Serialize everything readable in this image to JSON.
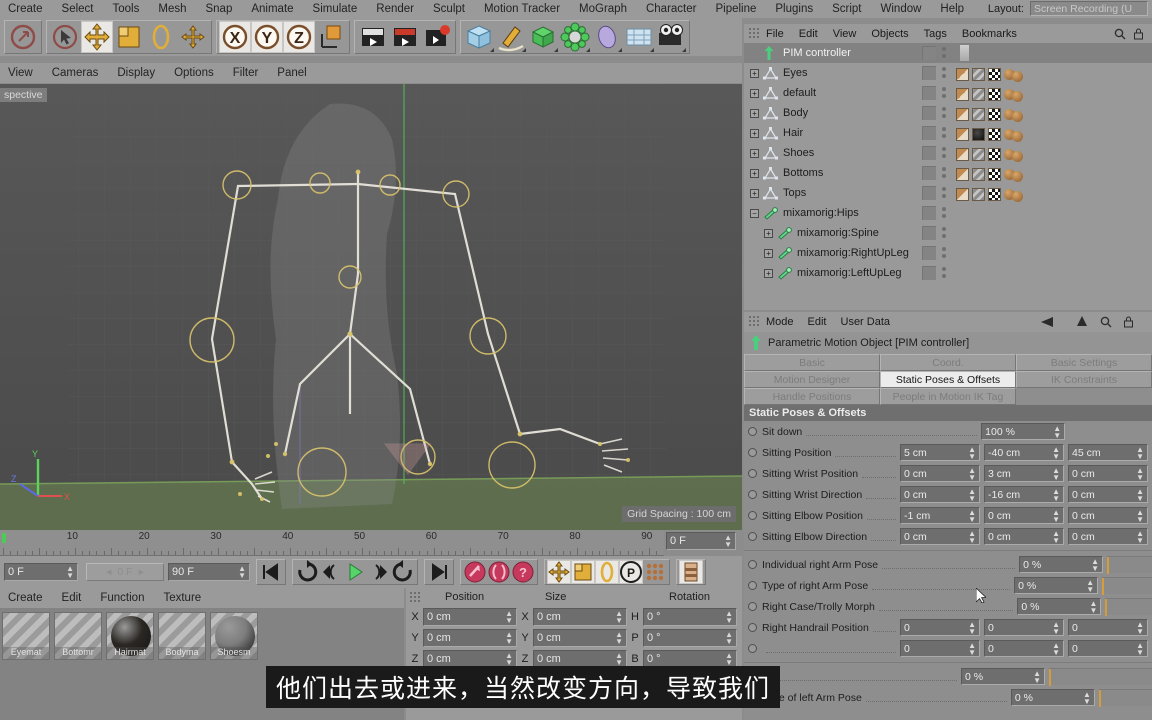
{
  "top_menu": {
    "items": [
      "Create",
      "Select",
      "Tools",
      "Mesh",
      "Snap",
      "Animate",
      "Simulate",
      "Render",
      "Sculpt",
      "Motion Tracker",
      "MoGraph",
      "Character",
      "Pipeline",
      "Plugins",
      "Script",
      "Window",
      "Help"
    ],
    "layout_label": "Layout:",
    "layout_value": "Screen Recording (U"
  },
  "toolbar": {
    "icons": [
      {
        "name": "undo-icon",
        "glyph": "↶"
      },
      {
        "name": "select-tool-icon",
        "glyph": "↖"
      },
      {
        "name": "move-tool-icon",
        "glyph": "✛"
      },
      {
        "name": "scale-tool-icon",
        "glyph": "◰"
      },
      {
        "name": "rotate-tool-icon",
        "glyph": "◯"
      },
      {
        "name": "world-axis-icon",
        "glyph": "✣"
      },
      {
        "name": "lock-x-axis-icon",
        "glyph": "X"
      },
      {
        "name": "lock-y-axis-icon",
        "glyph": "Y"
      },
      {
        "name": "lock-z-axis-icon",
        "glyph": "Z"
      },
      {
        "name": "object-world-coord-icon",
        "glyph": "◱"
      },
      {
        "name": "render-view-icon",
        "glyph": "▶"
      },
      {
        "name": "render-picture-viewer-icon",
        "glyph": "▶"
      },
      {
        "name": "render-settings-icon",
        "glyph": "▶"
      },
      {
        "name": "cube-primitive-icon",
        "glyph": "⬛"
      },
      {
        "name": "spline-pen-icon",
        "glyph": "✒"
      },
      {
        "name": "generator-icon",
        "glyph": "⬛"
      },
      {
        "name": "deformer-icon",
        "glyph": "✿"
      },
      {
        "name": "environment-icon",
        "glyph": "●"
      },
      {
        "name": "floor-scene-icon",
        "glyph": "▤"
      },
      {
        "name": "camera-icon",
        "glyph": "◎"
      }
    ]
  },
  "viewport": {
    "menu": [
      "View",
      "Cameras",
      "Display",
      "Options",
      "Filter",
      "Panel"
    ],
    "perspective_label": "spective",
    "grid_spacing": "Grid Spacing : 100 cm",
    "axis_labels": {
      "y": "Y",
      "x": "X",
      "z": "Z"
    },
    "corner_icons": [
      "move-view-icon",
      "pan-view-icon",
      "rotate-view-icon",
      "maximize-view-icon"
    ]
  },
  "timeline": {
    "ticks": [
      "10",
      "20",
      "30",
      "40",
      "50",
      "60",
      "70",
      "80",
      "90"
    ],
    "current_frame": "0 F",
    "start_field": "0 F",
    "preview_field": "0 F",
    "end_field": "90 F",
    "buttons": [
      {
        "name": "go-to-start-button",
        "glyph": "⏮"
      },
      {
        "name": "loop-preview-button",
        "glyph": "↻"
      },
      {
        "name": "step-back-button",
        "glyph": "◁"
      },
      {
        "name": "play-button",
        "glyph": "▶"
      },
      {
        "name": "step-forward-button",
        "glyph": "▷"
      },
      {
        "name": "loop-button",
        "glyph": "↺"
      },
      {
        "name": "go-to-end-button",
        "glyph": "⏭"
      },
      {
        "name": "record-keyframe-button",
        "glyph": "✦"
      },
      {
        "name": "autokey-button",
        "glyph": "●"
      },
      {
        "name": "keyframe-selection-button",
        "glyph": "?"
      },
      {
        "name": "key-position-button",
        "glyph": "✛"
      },
      {
        "name": "key-scale-button",
        "glyph": "◰"
      },
      {
        "name": "key-rotation-button",
        "glyph": "◯"
      },
      {
        "name": "key-pla-button",
        "glyph": "P"
      },
      {
        "name": "key-parameter-button",
        "glyph": "∷"
      },
      {
        "name": "timeline-layout-button",
        "glyph": "☰"
      }
    ]
  },
  "material_manager": {
    "menu": [
      "Create",
      "Edit",
      "Function",
      "Texture"
    ],
    "materials": [
      {
        "name": "Eyemat",
        "color": "#8a8a8a",
        "shine": false
      },
      {
        "name": "Bottomr",
        "color": "#8a8a8a",
        "shine": false
      },
      {
        "name": "Hairmat",
        "color": "#2b2723",
        "shine": true
      },
      {
        "name": "Bodyma",
        "color": "#8a8a8a",
        "shine": false
      },
      {
        "name": "Shoesm",
        "color": "#7d7d7d",
        "shine": true
      }
    ]
  },
  "coordinates": {
    "headers": [
      "Position",
      "Size",
      "Rotation"
    ],
    "rows": [
      {
        "axis1": "X",
        "pos": "0 cm",
        "axis2": "X",
        "size": "0 cm",
        "axis3": "H",
        "rot": "0 °"
      },
      {
        "axis1": "Y",
        "pos": "0 cm",
        "axis2": "Y",
        "size": "0 cm",
        "axis3": "P",
        "rot": "0 °"
      },
      {
        "axis1": "Z",
        "pos": "0 cm",
        "axis2": "Z",
        "size": "0 cm",
        "axis3": "B",
        "rot": "0 °"
      }
    ]
  },
  "object_manager": {
    "menu": [
      "File",
      "Edit",
      "View",
      "Objects",
      "Tags",
      "Bookmarks"
    ],
    "header_icons": [
      "search-icon",
      "lock-icon"
    ],
    "items": [
      {
        "label": "PIM controller",
        "icon": "pim-controller-icon",
        "indent": 0,
        "expander": "",
        "selected": true,
        "tags": []
      },
      {
        "label": "Eyes",
        "icon": "polygon-object-icon",
        "indent": 0,
        "expander": "+",
        "selected": false,
        "tags": [
          "texture-tag",
          "hair-tag",
          "checker-tag",
          "selection-tag"
        ]
      },
      {
        "label": "default",
        "icon": "polygon-object-icon",
        "indent": 0,
        "expander": "+",
        "selected": false,
        "tags": [
          "texture-tag",
          "hair-tag",
          "checker-tag",
          "selection-tag"
        ]
      },
      {
        "label": "Body",
        "icon": "polygon-object-icon",
        "indent": 0,
        "expander": "+",
        "selected": false,
        "tags": [
          "texture-tag",
          "hair-tag",
          "checker-tag",
          "selection-tag"
        ]
      },
      {
        "label": "Hair",
        "icon": "polygon-object-icon",
        "indent": 0,
        "expander": "+",
        "selected": false,
        "tags": [
          "texture-tag",
          "hair-dark-tag",
          "checker-tag",
          "selection-tag"
        ]
      },
      {
        "label": "Shoes",
        "icon": "polygon-object-icon",
        "indent": 0,
        "expander": "+",
        "selected": false,
        "tags": [
          "texture-tag",
          "hair-tag",
          "checker-tag",
          "selection-tag"
        ]
      },
      {
        "label": "Bottoms",
        "icon": "polygon-object-icon",
        "indent": 0,
        "expander": "+",
        "selected": false,
        "tags": [
          "texture-tag",
          "hair-tag",
          "checker-tag",
          "selection-tag"
        ]
      },
      {
        "label": "Tops",
        "icon": "polygon-object-icon",
        "indent": 0,
        "expander": "+",
        "selected": false,
        "tags": [
          "texture-tag",
          "hair-tag",
          "checker-tag",
          "selection-tag"
        ]
      },
      {
        "label": "mixamorig:Hips",
        "icon": "joint-icon",
        "indent": 0,
        "expander": "−",
        "selected": false,
        "tags": []
      },
      {
        "label": "mixamorig:Spine",
        "icon": "joint-icon",
        "indent": 1,
        "expander": "+",
        "selected": false,
        "tags": []
      },
      {
        "label": "mixamorig:RightUpLeg",
        "icon": "joint-icon",
        "indent": 1,
        "expander": "+",
        "selected": false,
        "tags": []
      },
      {
        "label": "mixamorig:LeftUpLeg",
        "icon": "joint-icon",
        "indent": 1,
        "expander": "+",
        "selected": false,
        "tags": []
      }
    ]
  },
  "attribute_manager": {
    "menu": [
      "Mode",
      "Edit",
      "User Data"
    ],
    "nav_icons": [
      "back-arrow-icon",
      "up-arrow-icon",
      "search-icon",
      "lock-icon"
    ],
    "object_title": "Parametric Motion Object [PIM controller]",
    "object_icon": "pim-controller-icon",
    "tabs": [
      [
        "Basic",
        "Coord.",
        "Basic Settings"
      ],
      [
        "Motion Designer",
        "Static Poses & Offsets",
        "IK Constraints"
      ],
      [
        "Handle Positions",
        "People in Motion IK Tag",
        ""
      ]
    ],
    "active_tab": "Static Poses & Offsets",
    "section_header": "Static Poses & Offsets",
    "params": [
      {
        "label": "Sit down",
        "values": [
          "100 %"
        ],
        "slider": false
      },
      {
        "label": "Sitting Position",
        "values": [
          "5 cm",
          "-40 cm",
          "45 cm"
        ],
        "slider": false
      },
      {
        "label": "Sitting Wrist Position",
        "values": [
          "0 cm",
          "3 cm",
          "0 cm"
        ],
        "slider": false
      },
      {
        "label": "Sitting Wrist Direction",
        "values": [
          "0 cm",
          "-16 cm",
          "0 cm"
        ],
        "slider": false
      },
      {
        "label": "Sitting Elbow Position",
        "values": [
          "-1 cm",
          "0 cm",
          "0 cm"
        ],
        "slider": false
      },
      {
        "label": "Sitting Elbow Direction",
        "values": [
          "0 cm",
          "0 cm",
          "0 cm"
        ],
        "slider": false
      },
      {
        "separator": true
      },
      {
        "label": "Individual right Arm Pose",
        "values": [
          "0 %"
        ],
        "slider": true
      },
      {
        "label": "Type of right Arm Pose",
        "values": [
          "0 %"
        ],
        "slider": true
      },
      {
        "label": "Right Case/Trolly Morph",
        "values": [
          "0 %"
        ],
        "slider": true
      },
      {
        "label": "Right Handrail Position",
        "values": [
          "0",
          "0",
          "0"
        ],
        "slider": false
      },
      {
        "label": "",
        "values": [
          "0",
          "0",
          "0"
        ],
        "slider": false
      },
      {
        "separator": true
      },
      {
        "label": "",
        "values": [
          "0 %"
        ],
        "slider": true
      },
      {
        "label": "Type of left Arm Pose",
        "values": [
          "0 %"
        ],
        "slider": true
      }
    ]
  },
  "subtitle": {
    "text": "他们出去或进来，当然改变方向，导致我们"
  },
  "colors": {
    "accent_orange": "#d79c3a",
    "green_play": "#56d46a",
    "panel_bg": "#9a9a9a",
    "field_bg": "#6e6e6e"
  }
}
